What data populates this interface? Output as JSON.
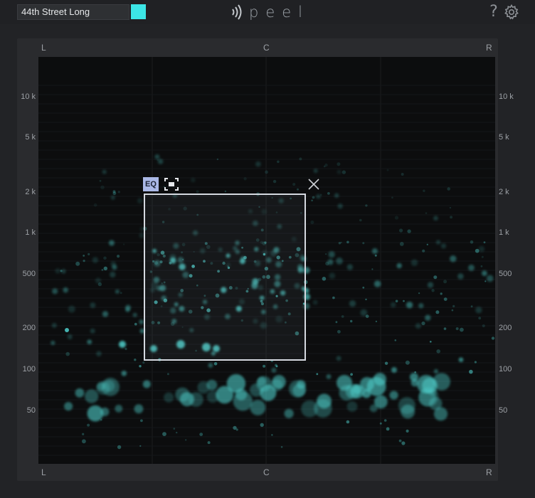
{
  "header": {
    "preset_name": "44th Street Long",
    "swatch_color": "#3ce6e6",
    "logo_text": "peel",
    "help_symbol": "?"
  },
  "pan_labels": {
    "left": "L",
    "center": "C",
    "right": "R"
  },
  "freq_labels": [
    "10 k",
    "5 k",
    "2 k",
    "1 k",
    "500",
    "200",
    "100",
    "50"
  ],
  "selection": {
    "eq_label": "EQ"
  },
  "colors": {
    "accent": "#3ce6e6",
    "dot": "#4fd0cc",
    "selection_border": "#d5d9e0",
    "eq_button": "#aab8e6"
  }
}
